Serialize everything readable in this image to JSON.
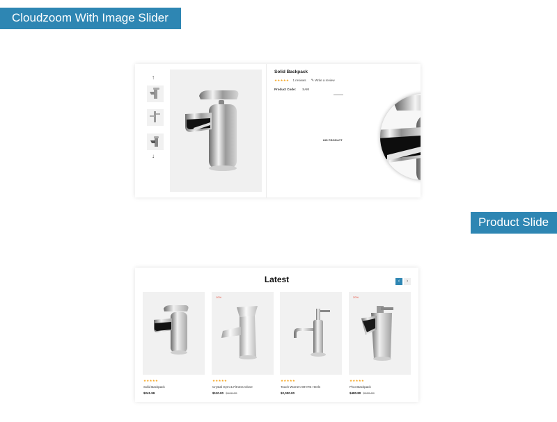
{
  "banners": {
    "top": "Cloudzoom With Image Slider",
    "right": "Product Slide"
  },
  "zoom_panel": {
    "arrow_up": "↑",
    "arrow_down": "↓",
    "product_title": "Solid Backpack",
    "stars": "★★★★★",
    "reviews": "1 reviews",
    "write_review_icon": "✎",
    "write_review": "Write a review",
    "code_label": "Product Code:",
    "code_value": "SAM",
    "wishlist_fragment": "HIS PRODUCT",
    "icons": [
      "arrow-up-icon",
      "arrow-down-icon",
      "pencil-icon"
    ]
  },
  "latest": {
    "title": "Latest",
    "prev": "‹",
    "next": "›",
    "products": [
      {
        "badge": "",
        "stars": "★★★★★",
        "name": "Solid Backpack",
        "price": "$241.99",
        "old_price": ""
      },
      {
        "badge": "10%",
        "stars": "★★★★★",
        "name": "Crystal Gym & Fitness Glove",
        "price": "$110.00",
        "old_price": "$122.00"
      },
      {
        "badge": "",
        "stars": "★★★★★",
        "name": "Touch Women WHITE Heels",
        "price": "$2,000.00",
        "old_price": ""
      },
      {
        "badge": "20%",
        "stars": "★★★★★",
        "name": "Pivot Backpack",
        "price": "$480.80",
        "old_price": "$600.00"
      }
    ]
  },
  "colors": {
    "accent": "#2e86b3",
    "star": "#f5a623",
    "sale_badge": "#e74c3c"
  }
}
